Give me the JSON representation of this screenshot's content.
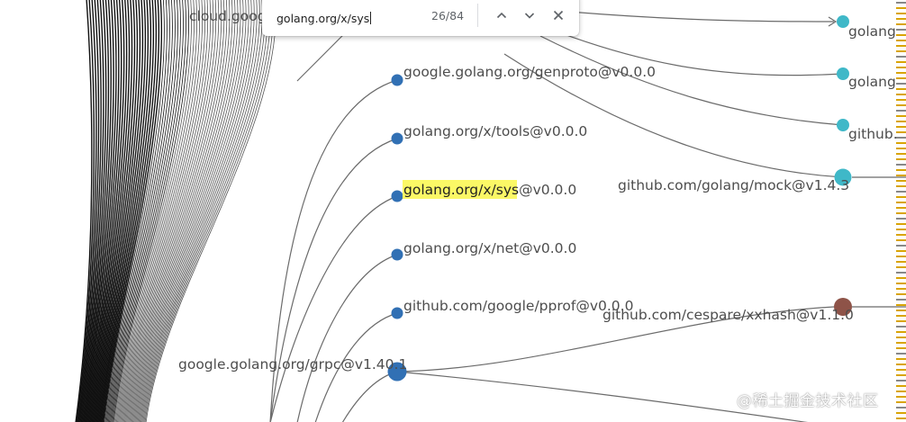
{
  "find_bar": {
    "query": "golang.org/x/sys",
    "match_count": "26/84"
  },
  "graph": {
    "nodes": [
      {
        "id": "cloud",
        "label": "cloud.goog",
        "color": "#3f78b5"
      },
      {
        "id": "genproto",
        "label": "google.golang.org/genproto@v0.0.0",
        "color": "#3170b4"
      },
      {
        "id": "tools",
        "label": "golang.org/x/tools@v0.0.0",
        "color": "#3170b4"
      },
      {
        "id": "sys",
        "label_highlight": "golang.org/x/sys",
        "label_rest": "@v0.0.0",
        "color": "#3170b4"
      },
      {
        "id": "net",
        "label": "golang.org/x/net@v0.0.0",
        "color": "#3170b4"
      },
      {
        "id": "pprof",
        "label": "github.com/google/pprof@v0.0.0",
        "color": "#3170b4"
      },
      {
        "id": "grpc",
        "label": "google.golang.org/grpc@v1.40.1",
        "color": "#3170b4"
      },
      {
        "id": "golang1",
        "label": "golang",
        "color": "#3fb8c8"
      },
      {
        "id": "golang2",
        "label": "golang",
        "color": "#3fb8c8"
      },
      {
        "id": "github",
        "label": "github.",
        "color": "#3fb8c8"
      },
      {
        "id": "mock",
        "label": "github.com/golang/mock@v1.4.3",
        "color": "#3fb8c8"
      },
      {
        "id": "xxhash",
        "label": "github.com/cespare/xxhash@v1.1.0",
        "color": "#8e5348"
      }
    ]
  },
  "colors": {
    "highlight": "#fbf866",
    "edge": "#6b6b6b",
    "stripe_accent": "#d9a406"
  },
  "watermark": "@稀土掘金技术社区",
  "icons": [
    "chevron-up-icon",
    "chevron-down-icon",
    "close-icon"
  ]
}
